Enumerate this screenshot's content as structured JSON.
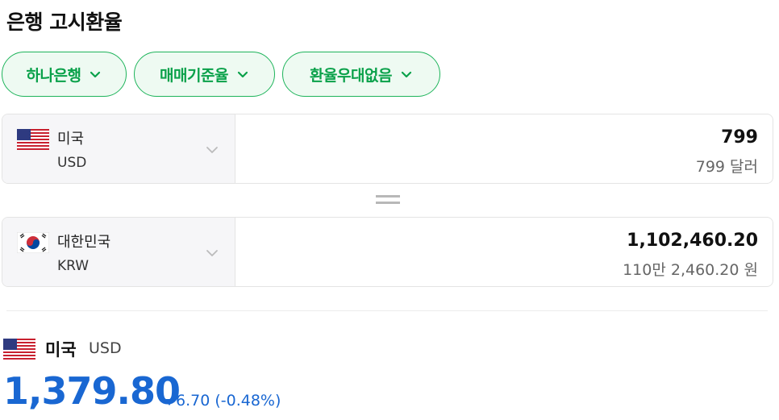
{
  "page_title": "은행 고시환율",
  "filters": [
    {
      "label": "하나은행",
      "icon": "chevron-down-icon"
    },
    {
      "label": "매매기준율",
      "icon": "chevron-down-icon"
    },
    {
      "label": "환율우대없음",
      "icon": "chevron-down-icon"
    }
  ],
  "from": {
    "country": "미국",
    "code": "USD",
    "flag": "us-flag-icon",
    "amount": "799",
    "amount_text": "799 달러"
  },
  "to": {
    "country": "대한민국",
    "code": "KRW",
    "flag": "kr-flag-icon",
    "amount": "1,102,460.20",
    "amount_text": "110만 2,460.20 원"
  },
  "summary": {
    "country": "미국",
    "code": "USD",
    "rate": "1,379.80",
    "change": "6.70 (-0.48%)",
    "direction": "down"
  },
  "colors": {
    "accent_green": "#0aa14a",
    "rate_blue": "#1967d2"
  }
}
